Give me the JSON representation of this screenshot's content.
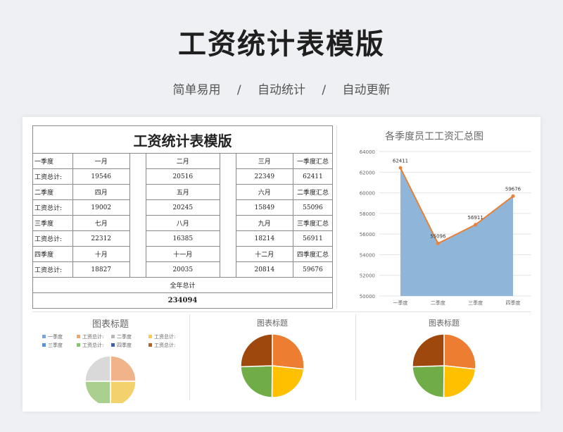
{
  "header": {
    "title": "工资统计表模版",
    "tags": [
      "简单易用",
      "自动统计",
      "自动更新"
    ],
    "sep": "/"
  },
  "table": {
    "title": "工资统计表模版",
    "quarters": [
      {
        "label": "一季度",
        "months": [
          "一月",
          "二月",
          "三月"
        ],
        "sum_label": "一季度汇总",
        "row_label": "工资总计:",
        "values": [
          "19546",
          "20516",
          "22349"
        ],
        "sum": "62411"
      },
      {
        "label": "二季度",
        "months": [
          "四月",
          "五月",
          "六月"
        ],
        "sum_label": "二季度汇总",
        "row_label": "工资总计:",
        "values": [
          "19002",
          "20245",
          "15849"
        ],
        "sum": "55096"
      },
      {
        "label": "三季度",
        "months": [
          "七月",
          "八月",
          "九月"
        ],
        "sum_label": "三季度汇总",
        "row_label": "工资总计:",
        "values": [
          "22312",
          "16385",
          "18214"
        ],
        "sum": "56911"
      },
      {
        "label": "四季度",
        "months": [
          "十月",
          "十一月",
          "十二月"
        ],
        "sum_label": "四季度汇总",
        "row_label": "工资总计:",
        "values": [
          "18827",
          "20035",
          "20814"
        ],
        "sum": "59676"
      }
    ],
    "annual_label": "全年总计",
    "annual_total": "234094"
  },
  "chart_data": [
    {
      "type": "area",
      "title": "各季度员工工资汇总图",
      "categories": [
        "一季度",
        "二季度",
        "三季度",
        "四季度"
      ],
      "values": [
        62411,
        55096,
        56911,
        59676
      ],
      "ylim": [
        50000,
        64000
      ],
      "yticks": [
        50000,
        52000,
        54000,
        56000,
        58000,
        60000,
        62000,
        64000
      ],
      "grid": true,
      "fill": "#8fb5d9",
      "line": "#e8823a"
    },
    {
      "type": "pie",
      "title": "图表标题",
      "legend": [
        "一季度",
        "工资总计:",
        "二季度",
        "工资总计:",
        "三季度",
        "工资总计:",
        "四季度",
        "工资总计:"
      ],
      "legend_colors": [
        "#7ba4d8",
        "#f4a46c",
        "#b7b7b7",
        "#ffc94a",
        "#5a8fd6",
        "#7ecb65",
        "#3f5fa8",
        "#b5651d"
      ],
      "values": [
        25,
        25,
        25,
        25
      ],
      "colors": [
        "#f0b38a",
        "#f3d26e",
        "#a9d08e",
        "#d9d9d9"
      ],
      "legend_position": "top"
    },
    {
      "type": "pie",
      "title": "图表标题",
      "values": [
        26.7,
        23.5,
        24.3,
        25.5
      ],
      "colors": [
        "#ed7d31",
        "#ffc000",
        "#70ad47",
        "#9e480e"
      ]
    },
    {
      "type": "pie",
      "title": "图表标题",
      "values": [
        26.7,
        23.5,
        24.3,
        25.5
      ],
      "colors": [
        "#ed7d31",
        "#ffc000",
        "#70ad47",
        "#9e480e"
      ]
    }
  ]
}
